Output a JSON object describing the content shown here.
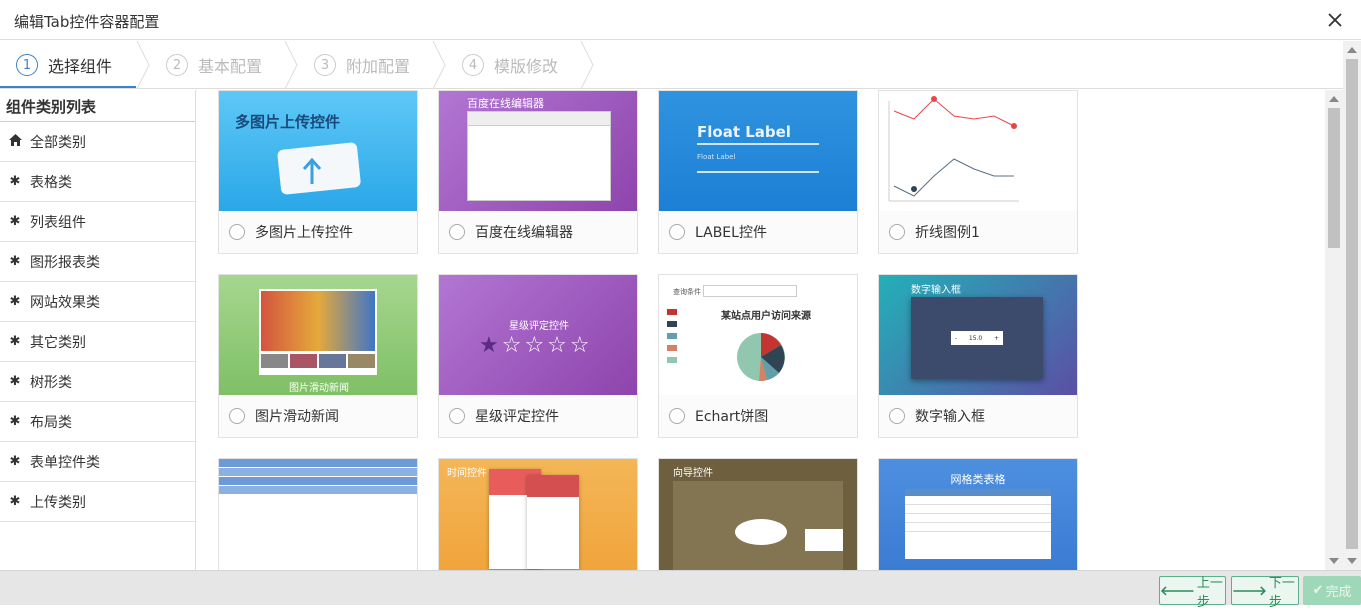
{
  "dialog": {
    "title": "编辑Tab控件容器配置"
  },
  "steps": [
    {
      "num": "1",
      "label": "选择组件",
      "active": true
    },
    {
      "num": "2",
      "label": "基本配置"
    },
    {
      "num": "3",
      "label": "附加配置"
    },
    {
      "num": "4",
      "label": "模版修改"
    }
  ],
  "sidebar": {
    "heading": "组件类别列表",
    "items": [
      {
        "icon": "home-icon",
        "label": "全部类别"
      },
      {
        "icon": "asterisk-icon",
        "label": "表格类"
      },
      {
        "icon": "asterisk-icon",
        "label": "列表组件"
      },
      {
        "icon": "asterisk-icon",
        "label": "图形报表类"
      },
      {
        "icon": "asterisk-icon",
        "label": "网站效果类"
      },
      {
        "icon": "asterisk-icon",
        "label": "其它类别"
      },
      {
        "icon": "asterisk-icon",
        "label": "树形类"
      },
      {
        "icon": "asterisk-icon",
        "label": "布局类"
      },
      {
        "icon": "asterisk-icon",
        "label": "表单控件类"
      },
      {
        "icon": "asterisk-icon",
        "label": "上传类别"
      }
    ]
  },
  "components": [
    {
      "name": "多图片上传控件",
      "thumb_text": "多图片上传控件"
    },
    {
      "name": "百度在线编辑器",
      "thumb_text": "百度在线编辑器"
    },
    {
      "name": "LABEL控件",
      "thumb_text": "Float Label",
      "thumb_sub": "Float Label"
    },
    {
      "name": "折线图例1"
    },
    {
      "name": "图片滑动新闻",
      "thumb_text": "图片滑动新闻"
    },
    {
      "name": "星级评定控件",
      "thumb_text": "星级评定控件"
    },
    {
      "name": "Echart饼图",
      "thumb_text": "某站点用户访问来源",
      "thumb_sub": "查询条件"
    },
    {
      "name": "数字输入框",
      "thumb_text": "数字输入框",
      "thumb_sub": "15.0"
    },
    {
      "name": ""
    },
    {
      "name": "",
      "thumb_text": "时间控件"
    },
    {
      "name": "",
      "thumb_text": "向导控件"
    },
    {
      "name": "",
      "thumb_text": "网格类表格"
    }
  ],
  "footer": {
    "prev_label": "上一步",
    "next_label": "下一步",
    "finish_label": "完成"
  },
  "colors": {
    "accent": "#3a84c5",
    "button_green": "#2f8c5c"
  }
}
